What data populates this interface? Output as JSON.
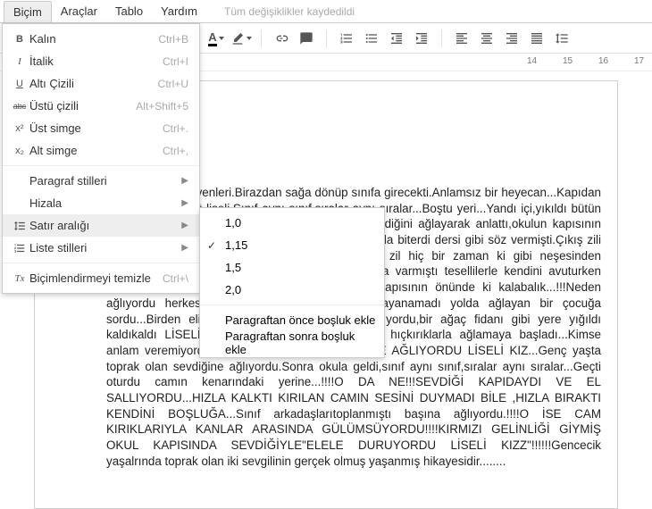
{
  "menubar": {
    "items": [
      "Biçim",
      "Araçlar",
      "Tablo",
      "Yardım"
    ],
    "status": "Tüm değişiklikler kaydedildi"
  },
  "format_menu": {
    "bold": {
      "label": "Kalın",
      "shortcut": "Ctrl+B",
      "icon": "B"
    },
    "italic": {
      "label": "İtalik",
      "shortcut": "Ctrl+I",
      "icon": "I"
    },
    "underline": {
      "label": "Altı Çizili",
      "shortcut": "Ctrl+U",
      "icon": "U"
    },
    "strike": {
      "label": "Üstü çizili",
      "shortcut": "Alt+Shift+5",
      "icon": "abc"
    },
    "superscript": {
      "label": "Üst simge",
      "shortcut": "Ctrl+.",
      "icon": "x²"
    },
    "subscript": {
      "label": "Alt simge",
      "shortcut": "Ctrl+,",
      "icon": "x₂"
    },
    "paragraph_styles": {
      "label": "Paragraf stilleri"
    },
    "align": {
      "label": "Hizala"
    },
    "line_spacing": {
      "label": "Satır aralığı"
    },
    "list_styles": {
      "label": "Liste stilleri"
    },
    "clear": {
      "label": "Biçimlendirmeyi temizle",
      "shortcut": "Ctrl+\\",
      "icon": "Tx"
    }
  },
  "line_spacing_menu": {
    "opt1": "1,0",
    "opt2": "1,15",
    "opt3": "1,5",
    "opt4": "2,0",
    "before": "Paragraftan önce boşluk ekle",
    "after": "Paragraftan sonra boşluk ekle",
    "selected": "1,15"
  },
  "ruler": {
    "n14": "14",
    "n15": "15",
    "n16": "16",
    "n17": "17"
  },
  "document": {
    "body": "manıyordu merdivenleri.Birazdan sağa dönüp sınıfa girecekti.Anlamsız bir heyecan...Kapıdan seyredildi bir sürü liseli.Sınıf aynı sınıf,sıralar aynı sıralar...Boştu yeri...Yandı içi,yıkıldı bütün ümitleri!!!Bir kaç gün öncesi saklandı aklında...Sevdiğini ağlayarak anlattı,okulun kapısının çiftlerini ezberlemişti,ne olursa olsun hep aynı kapıda biterdi dersi gibi söz vermişti.Çıkış zili çaldığında son sıranın camdan kenarında çalan zil hiç bir zaman ki gibi neşesinden uzaktı.Ağır ağır inmişti merdivenleri...Okul kapısına varmıştı tesellilerle kendini avuturken mahalleye gelmişti...Fakat bu da neydi,mahalle kapısının önünde ki kalabalık...!!!Neden ağlıyordu herkes?Çocuklar,gençler,LİSELİ KIZ...Dayanamadı yolda ağlayan bir çocuğa sordu...Birden elindeki çantası düştü,dişleri kararıyordu,bir ağaç fidanı gibi yere yığıldı kaldıkaldı LİSELİ KIZ...Konuşmak istiyordu,birden hıçkırıklarla ağlamaya başladı...Kimse anlam veremiyordu neden ağladığına...SEVDİĞİNE AĞLIYORDU LİSELİ KIZ...Genç yaşta toprak olan sevdiğine ağlıyordu.Sonra okula geldi,sınıf aynı sınıf,sıralar aynı sıralar...Geçti oturdu camın kenarındaki yerine...!!!!O DA NE!!!SEVDİĞİ KAPIDAYDI VE EL SALLIYORDU...HIZLA KALKTI KIRILAN CAMIN SESİNİ DUYMADI BİLE ,HIZLA BIRAKTI KENDİNİ BOŞLUĞA...Sınıf arkadaşlarıtoplanmıştı başına ağlıyordu.!!!!O İSE CAM KIRIKLARIYLA KANLAR ARASINDA GÜLÜMSÜYORDU!!!!KIRMIZI GELİNLİĞİ GİYMİŞ OKUL KAPISINDA SEVDİĞİYLE\"ELELE DURUYORDU LİSELİ KIZZ\"!!!!!!Gencecik yaşalrında toprak olan iki sevgilinin gerçek olmuş yaşanmış hikayesidir........"
  }
}
